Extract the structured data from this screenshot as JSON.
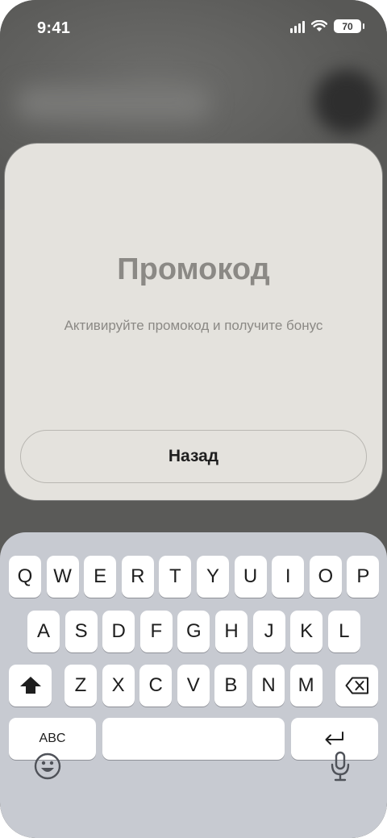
{
  "status_bar": {
    "time": "9:41",
    "battery": "70",
    "icons": [
      "signal-icon",
      "wifi-icon",
      "battery-icon"
    ]
  },
  "promo_sheet": {
    "title": "Промокод",
    "subtitle": "Активируйте промокод и получите бонус",
    "back_button_label": "Назад"
  },
  "keyboard": {
    "row1": [
      "Q",
      "W",
      "E",
      "R",
      "T",
      "Y",
      "U",
      "I",
      "O",
      "P"
    ],
    "row2": [
      "A",
      "S",
      "D",
      "F",
      "G",
      "H",
      "J",
      "K",
      "L"
    ],
    "row3": [
      "Z",
      "X",
      "C",
      "V",
      "B",
      "N",
      "M"
    ],
    "abc_label": "ABC",
    "icons": [
      "shift-icon",
      "backspace-icon",
      "return-icon",
      "emoji-icon",
      "microphone-icon"
    ]
  },
  "colors": {
    "backdrop": "#5a5a58",
    "sheet": "#e4e2dd",
    "muted_text": "#8b8985",
    "keyboard": "#c7cad1"
  }
}
